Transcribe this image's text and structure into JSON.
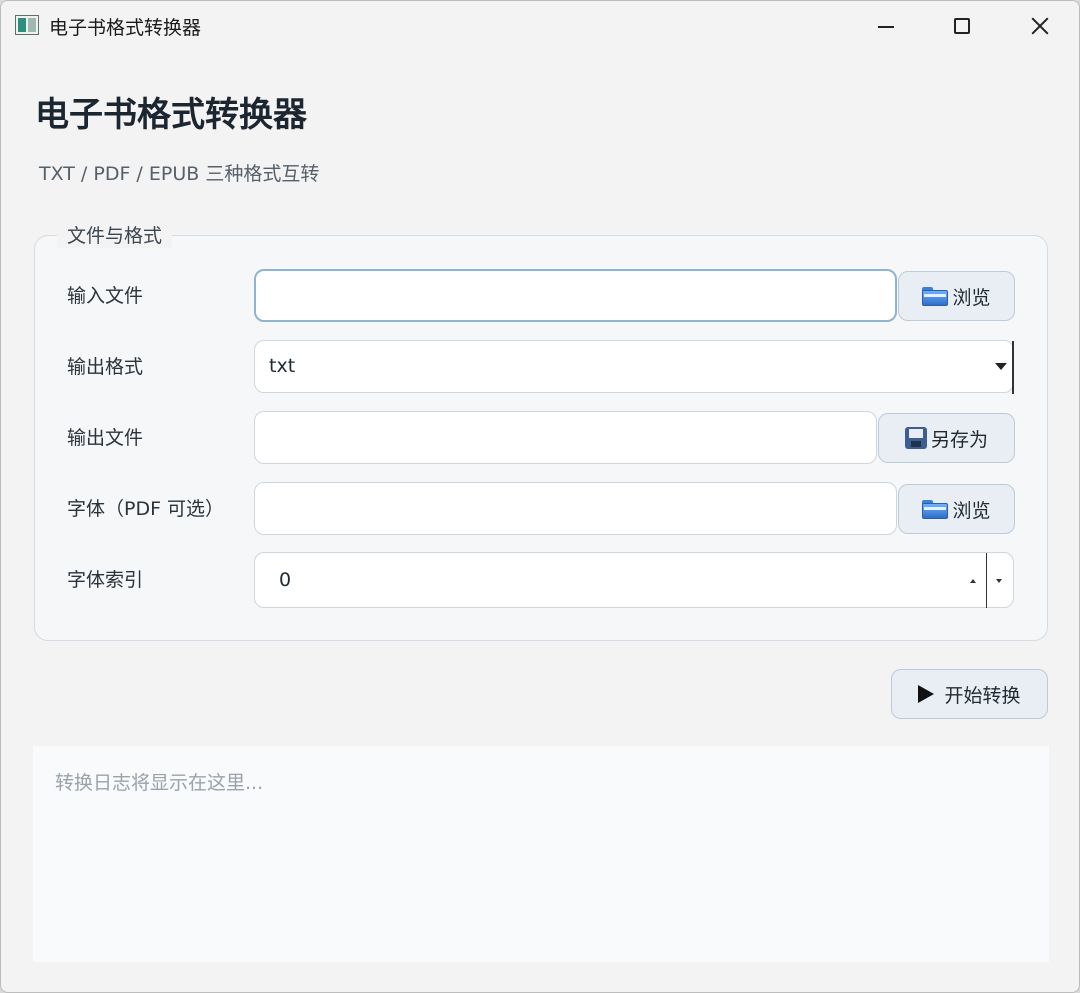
{
  "window": {
    "title": "电子书格式转换器"
  },
  "header": {
    "title": "电子书格式转换器",
    "subtitle": "TXT / PDF / EPUB 三种格式互转"
  },
  "group": {
    "legend": "文件与格式",
    "input_file": {
      "label": "输入文件",
      "value": "",
      "browse_label": "浏览"
    },
    "output_format": {
      "label": "输出格式",
      "selected": "txt"
    },
    "output_file": {
      "label": "输出文件",
      "value": "",
      "save_as_label": "另存为"
    },
    "font": {
      "label": "字体（PDF 可选）",
      "value": "",
      "browse_label": "浏览"
    },
    "font_index": {
      "label": "字体索引",
      "value": "0"
    }
  },
  "actions": {
    "start_label": "开始转换"
  },
  "log": {
    "placeholder": "转换日志将显示在这里..."
  },
  "icons": {
    "app": "app-icon",
    "browse": "folder-icon",
    "save": "floppy-disk-icon",
    "start": "play-icon"
  },
  "colors": {
    "focus_border": "#8fb4d1",
    "button_bg": "#e8eef4",
    "window_bg": "#f3f3f3"
  }
}
